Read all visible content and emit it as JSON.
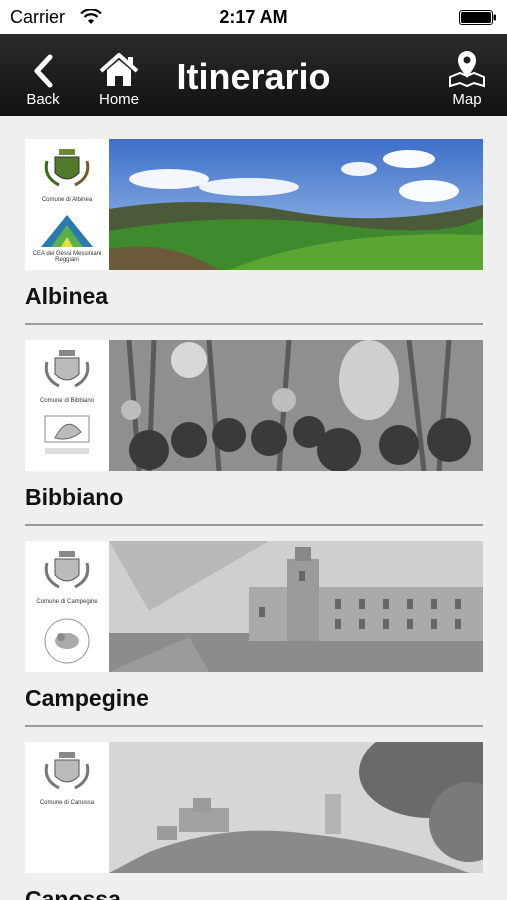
{
  "status_bar": {
    "carrier": "Carrier",
    "time": "2:17 AM"
  },
  "nav": {
    "back_label": "Back",
    "home_label": "Home",
    "title": "Itinerario",
    "map_label": "Map"
  },
  "items": [
    {
      "name": "Albinea",
      "logo_top_caption": "Comune di Albinea",
      "logo_bottom_caption": "CEA dei Gessi Messiniani Reggiani"
    },
    {
      "name": "Bibbiano",
      "logo_top_caption": "Comune di Bibbiano",
      "logo_bottom_caption": ""
    },
    {
      "name": "Campegine",
      "logo_top_caption": "Comune di Campegine",
      "logo_bottom_caption": ""
    },
    {
      "name": "Canossa",
      "logo_top_caption": "Comune di Canossa",
      "logo_bottom_caption": ""
    }
  ]
}
